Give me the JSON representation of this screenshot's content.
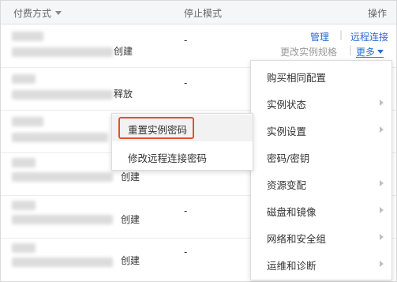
{
  "header": {
    "payment_label": "付费方式",
    "stop_mode_label": "停止模式",
    "ops_label": "操作"
  },
  "rows": [
    {
      "text": "创建",
      "stop_mode": "-"
    },
    {
      "text": "释放",
      "stop_mode": "-"
    },
    {
      "text": "",
      "stop_mode": ""
    },
    {
      "text": "创建",
      "stop_mode": "-"
    },
    {
      "text": "创建",
      "stop_mode": "-"
    },
    {
      "text": "创建",
      "stop_mode": "-"
    }
  ],
  "ops": {
    "manage": "管理",
    "separator": "|",
    "remote_connect": "远程连接",
    "change_spec": "更改实例规格",
    "more": "更多"
  },
  "menu": {
    "items": [
      {
        "label": "购买相同配置",
        "has_submenu": false
      },
      {
        "label": "实例状态",
        "has_submenu": true
      },
      {
        "label": "实例设置",
        "has_submenu": true
      },
      {
        "label": "密码/密钥",
        "has_submenu": false
      },
      {
        "label": "资源变配",
        "has_submenu": true
      },
      {
        "label": "磁盘和镜像",
        "has_submenu": true
      },
      {
        "label": "网络和安全组",
        "has_submenu": true
      },
      {
        "label": "运维和诊断",
        "has_submenu": true
      }
    ]
  },
  "submenu": {
    "items": [
      {
        "label": "重置实例密码",
        "highlighted": true
      },
      {
        "label": "修改远程连接密码",
        "highlighted": false
      }
    ]
  },
  "colors": {
    "link": "#2a6bd1",
    "highlight_border": "#e0532b"
  }
}
